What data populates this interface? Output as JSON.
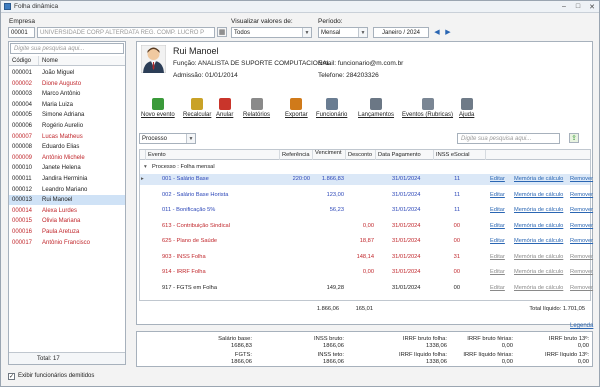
{
  "window": {
    "title": "Folha dinâmica"
  },
  "filters": {
    "empresa_label": "Empresa",
    "empresa_code": "00001",
    "empresa_name": "UNIVERSIDADE CORP ALTERDATA REG. COMP. LUCRO P",
    "valores_label": "Visualizar valores de:",
    "valores_value": "Todos",
    "periodo_label": "Período:",
    "periodo_value": "Mensal",
    "periodo_month": "Janeiro / 2024"
  },
  "employee_list": {
    "search_placeholder": "Digite sua pesquisa aqui...",
    "col_codigo": "Código",
    "col_nome": "Nome",
    "items": [
      {
        "code": "000001",
        "name": "João Miguel",
        "style": "blk"
      },
      {
        "code": "000002",
        "name": "Dione Augusto",
        "style": "red"
      },
      {
        "code": "000003",
        "name": "Marco Antônio",
        "style": "blk"
      },
      {
        "code": "000004",
        "name": "Maria Luiza",
        "style": "blk"
      },
      {
        "code": "000005",
        "name": "Simone Adriana",
        "style": "blk"
      },
      {
        "code": "000006",
        "name": "Rogério Aurelio",
        "style": "blk"
      },
      {
        "code": "000007",
        "name": "Lucas Matheus",
        "style": "red"
      },
      {
        "code": "000008",
        "name": "Eduardo Elias",
        "style": "blk"
      },
      {
        "code": "000009",
        "name": "Antônio Michele",
        "style": "red"
      },
      {
        "code": "000010",
        "name": "Janete Helena",
        "style": "blk"
      },
      {
        "code": "000011",
        "name": "Jandira Herminia",
        "style": "blk"
      },
      {
        "code": "000012",
        "name": "Leandro Mariano",
        "style": "blk"
      },
      {
        "code": "000013",
        "name": "Rui Manoel",
        "style": "sel"
      },
      {
        "code": "000014",
        "name": "Alexa Lurdes",
        "style": "red"
      },
      {
        "code": "000015",
        "name": "Olivia Mariana",
        "style": "red"
      },
      {
        "code": "000016",
        "name": "Paula Aretuza",
        "style": "red"
      },
      {
        "code": "000017",
        "name": "Antônio Francisco",
        "style": "red"
      }
    ],
    "total": "Total: 17",
    "show_dismissed_label": "Exibir funcionários demitidos"
  },
  "employee": {
    "name": "Rui Manoel",
    "funcao": "Função: ANALISTA DE SUPORTE COMPUTACIONAL",
    "admissao": "Admissão: 01/01/2014",
    "email": "Email: funcionario@m.com.br",
    "telefone": "Telefone: 284203326"
  },
  "toolbar": {
    "items": [
      {
        "label": "Novo evento",
        "color": "#3a9a3a"
      },
      {
        "label": "Recalcular",
        "color": "#c9a227"
      },
      {
        "label": "Anular",
        "color": "#c9352b"
      },
      {
        "label": "Relatórios",
        "color": "#8a8a8a"
      },
      {
        "label": "Exportar",
        "color": "#d07a1a"
      },
      {
        "label": "Funcionário",
        "color": "#6a7d92"
      },
      {
        "label": "Lançamentos",
        "color": "#6b7785"
      },
      {
        "label": "Eventos (Rubricas)",
        "color": "#7a8694"
      },
      {
        "label": "Ajuda",
        "color": "#6f7b88"
      }
    ]
  },
  "grid": {
    "group_select": "Processo",
    "search_placeholder": "Digite sua pesquisa aqui...",
    "headers": {
      "evento": "Evento",
      "referencia": "Referência",
      "vencimento": "Venciment",
      "desconto": "Desconto",
      "data": "Data Pagamento",
      "inss": "INSS eSocial"
    },
    "group_label": "Processo : Folha mensal",
    "rows": [
      {
        "evento": "001 - Salário Base",
        "ref": "220:00",
        "venc": "1.866,83",
        "desc": "",
        "data": "31/01/2024",
        "inss": "11",
        "color": "blue",
        "active": true,
        "highlight": true
      },
      {
        "evento": "002 - Salário Base Horista",
        "ref": "",
        "venc": "123,00",
        "desc": "",
        "data": "31/01/2024",
        "inss": "11",
        "color": "blue",
        "active": true,
        "highlight": false
      },
      {
        "evento": "011 - Bonificação 5%",
        "ref": "",
        "venc": "56,23",
        "desc": "",
        "data": "31/01/2024",
        "inss": "11",
        "color": "blue",
        "active": true,
        "highlight": false
      },
      {
        "evento": "613 - Contribuição Sindical",
        "ref": "",
        "venc": "",
        "desc": "0,00",
        "data": "31/01/2024",
        "inss": "00",
        "color": "red",
        "active": true,
        "highlight": false
      },
      {
        "evento": "625 - Plano de Saúde",
        "ref": "",
        "venc": "",
        "desc": "18,87",
        "data": "31/01/2024",
        "inss": "00",
        "color": "red",
        "active": true,
        "highlight": false
      },
      {
        "evento": "903 - INSS Folha",
        "ref": "",
        "venc": "",
        "desc": "148,14",
        "data": "31/01/2024",
        "inss": "31",
        "color": "red",
        "active": false,
        "highlight": false
      },
      {
        "evento": "914 - IRRF Folha",
        "ref": "",
        "venc": "",
        "desc": "0,00",
        "data": "31/01/2024",
        "inss": "00",
        "color": "red",
        "active": false,
        "highlight": false
      },
      {
        "evento": "917 - FGTS em Folha",
        "ref": "",
        "venc": "149,28",
        "desc": "",
        "data": "31/01/2024",
        "inss": "00",
        "color": "black",
        "active": false,
        "highlight": false
      }
    ],
    "action_edit": "Editar",
    "action_memo": "Memória de cálculo",
    "action_remove": "Remover",
    "sum_venc": "1.866,06",
    "sum_desc": "165,01",
    "total_liquido": "Total líquido: 1.701,05",
    "legend_link": "Legenda"
  },
  "footer": {
    "salario_base_label": "Salário base:",
    "salario_base": "1686,83",
    "fgts_label": "FGTS:",
    "fgts": "1866,06",
    "inss_bruto_label": "INSS bruto:",
    "inss_bruto": "1866,06",
    "inss_teto_label": "INSS teto:",
    "inss_teto": "1866,06",
    "irrf_bruto_label": "IRRF bruto folha:",
    "irrf_bruto": "1338,06",
    "irrf_liq_label": "IRRF líquido folha:",
    "irrf_liq": "1338,06",
    "irrf_ferias_label": "IRRF bruto férias:",
    "irrf_ferias": "0,00",
    "irrf_liq_ferias_label": "IRRF líquido férias:",
    "irrf_liq_ferias": "0,00",
    "irrf_13_label": "IRRF bruto 13º:",
    "irrf_13": "0,00",
    "irrf_liq_13_label": "IRRF líquido 13º:",
    "irrf_liq_13": "0,00"
  }
}
